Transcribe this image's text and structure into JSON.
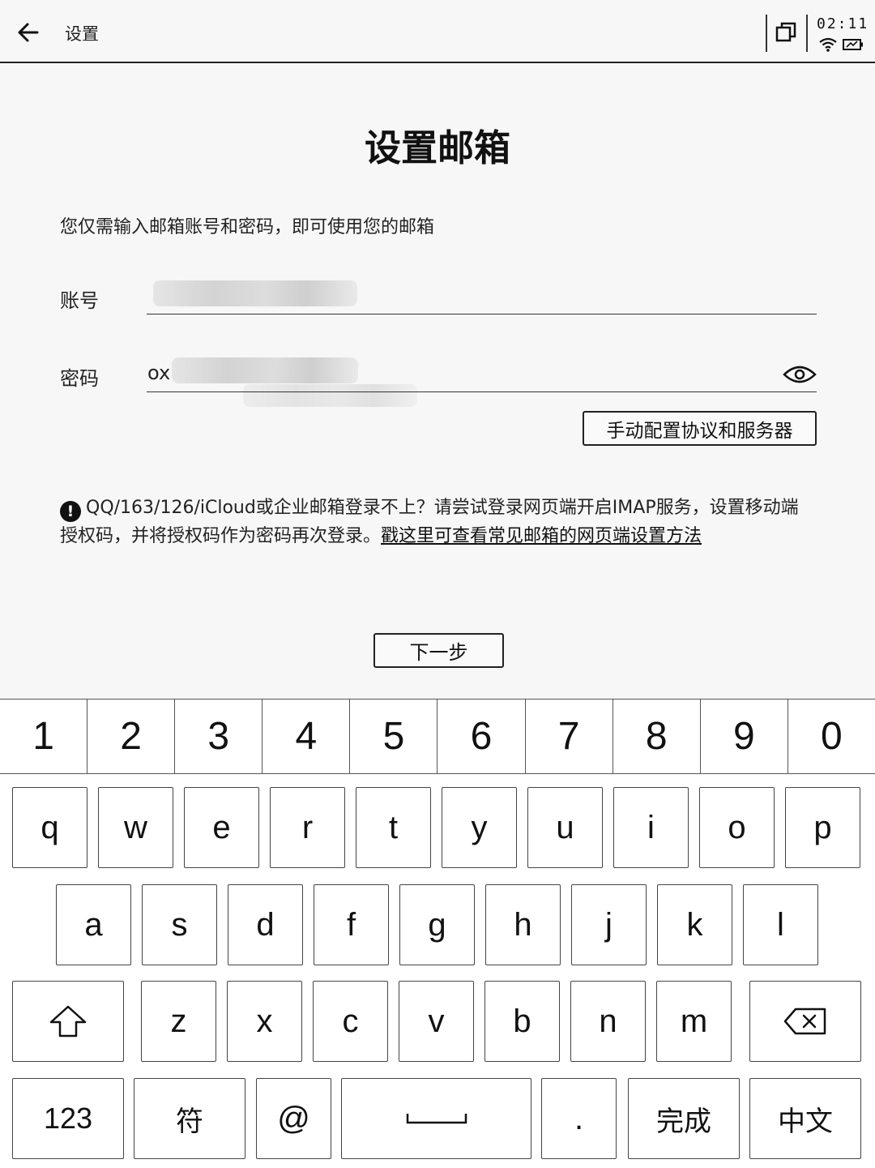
{
  "topbar": {
    "title": "设置",
    "time": "02:11"
  },
  "page": {
    "title": "设置邮箱",
    "intro": "您仅需输入邮箱账号和密码，即可使用您的邮箱",
    "account_label": "账号",
    "password_label": "密码",
    "password_prefix": "ox",
    "manual_config_label": "手动配置协议和服务器",
    "notice_text": "QQ/163/126/iCloud或企业邮箱登录不上？请尝试登录网页端开启IMAP服务，设置移动端授权码，并将授权码作为密码再次登录。",
    "notice_link": "戳这里可查看常见邮箱的网页端设置方法",
    "next_label": "下一步"
  },
  "keyboard": {
    "numbers": [
      "1",
      "2",
      "3",
      "4",
      "5",
      "6",
      "7",
      "8",
      "9",
      "0"
    ],
    "row1": [
      "q",
      "w",
      "e",
      "r",
      "t",
      "y",
      "u",
      "i",
      "o",
      "p"
    ],
    "row2": [
      "a",
      "s",
      "d",
      "f",
      "g",
      "h",
      "j",
      "k",
      "l"
    ],
    "row3": [
      "z",
      "x",
      "c",
      "v",
      "b",
      "n",
      "m"
    ],
    "num_mode": "123",
    "symbols": "符",
    "at": "@",
    "period": ".",
    "done": "完成",
    "lang": "中文"
  }
}
